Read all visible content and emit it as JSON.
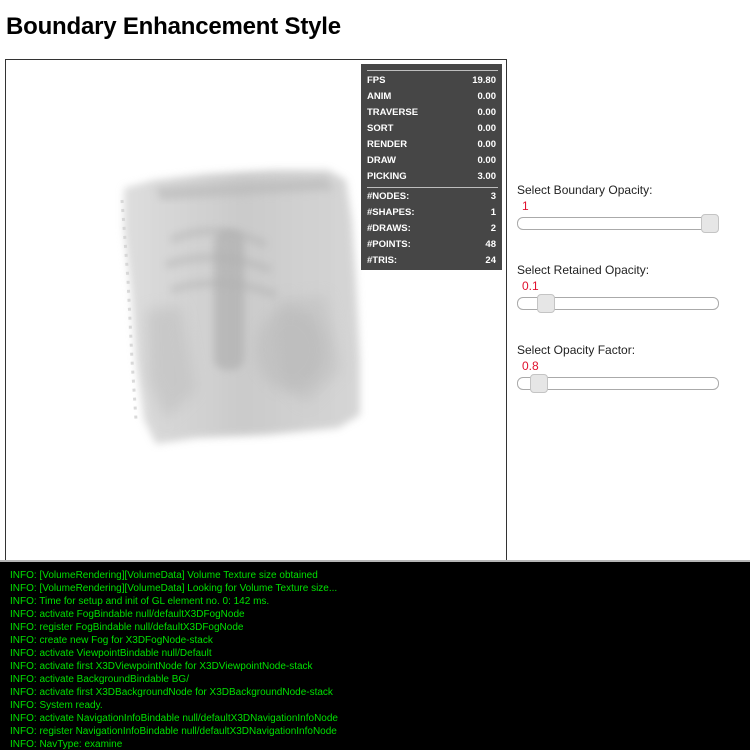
{
  "page": {
    "title": "Boundary Enhancement Style"
  },
  "stats": {
    "timings": [
      {
        "label": "FPS",
        "value": "19.80"
      },
      {
        "label": "ANIM",
        "value": "0.00"
      },
      {
        "label": "TRAVERSE",
        "value": "0.00"
      },
      {
        "label": "SORT",
        "value": "0.00"
      },
      {
        "label": "RENDER",
        "value": "0.00"
      },
      {
        "label": "DRAW",
        "value": "0.00"
      },
      {
        "label": "PICKING",
        "value": "3.00"
      }
    ],
    "counts": [
      {
        "label": "#NODES:",
        "value": "3"
      },
      {
        "label": "#SHAPES:",
        "value": "1"
      },
      {
        "label": "#DRAWS:",
        "value": "2"
      },
      {
        "label": "#POINTS:",
        "value": "48"
      },
      {
        "label": "#TRIS:",
        "value": "24"
      }
    ]
  },
  "controls": {
    "boundary_opacity": {
      "label": "Select Boundary Opacity:",
      "value": "1",
      "level": 1.0
    },
    "retained_opacity": {
      "label": "Select Retained Opacity:",
      "value": "0.1",
      "level": 0.1
    },
    "opacity_factor": {
      "label": "Select Opacity Factor:",
      "value": "0.8",
      "level": 0.06
    }
  },
  "log": [
    "INFO: [VolumeRendering][VolumeData] Volume Texture size obtained",
    "INFO: [VolumeRendering][VolumeData] Looking for Volume Texture size...",
    "INFO: Time for setup and init of GL element no. 0: 142 ms.",
    "INFO: activate FogBindable null/defaultX3DFogNode",
    "INFO: register FogBindable null/defaultX3DFogNode",
    "INFO: create new Fog for X3DFogNode-stack",
    "INFO: activate ViewpointBindable null/Default",
    "INFO: activate first X3DViewpointNode for X3DViewpointNode-stack",
    "INFO: activate BackgroundBindable BG/",
    "INFO: activate first X3DBackgroundNode for X3DBackgroundNode-stack",
    "INFO: System ready.",
    "INFO: activate NavigationInfoBindable null/defaultX3DNavigationInfoNode",
    "INFO: register NavigationInfoBindable null/defaultX3DNavigationInfoNode",
    "INFO: NavType: examine"
  ],
  "colors": {
    "stats_background": "#464646",
    "log_text": "#00e000",
    "slider_value": "#e0102e"
  }
}
